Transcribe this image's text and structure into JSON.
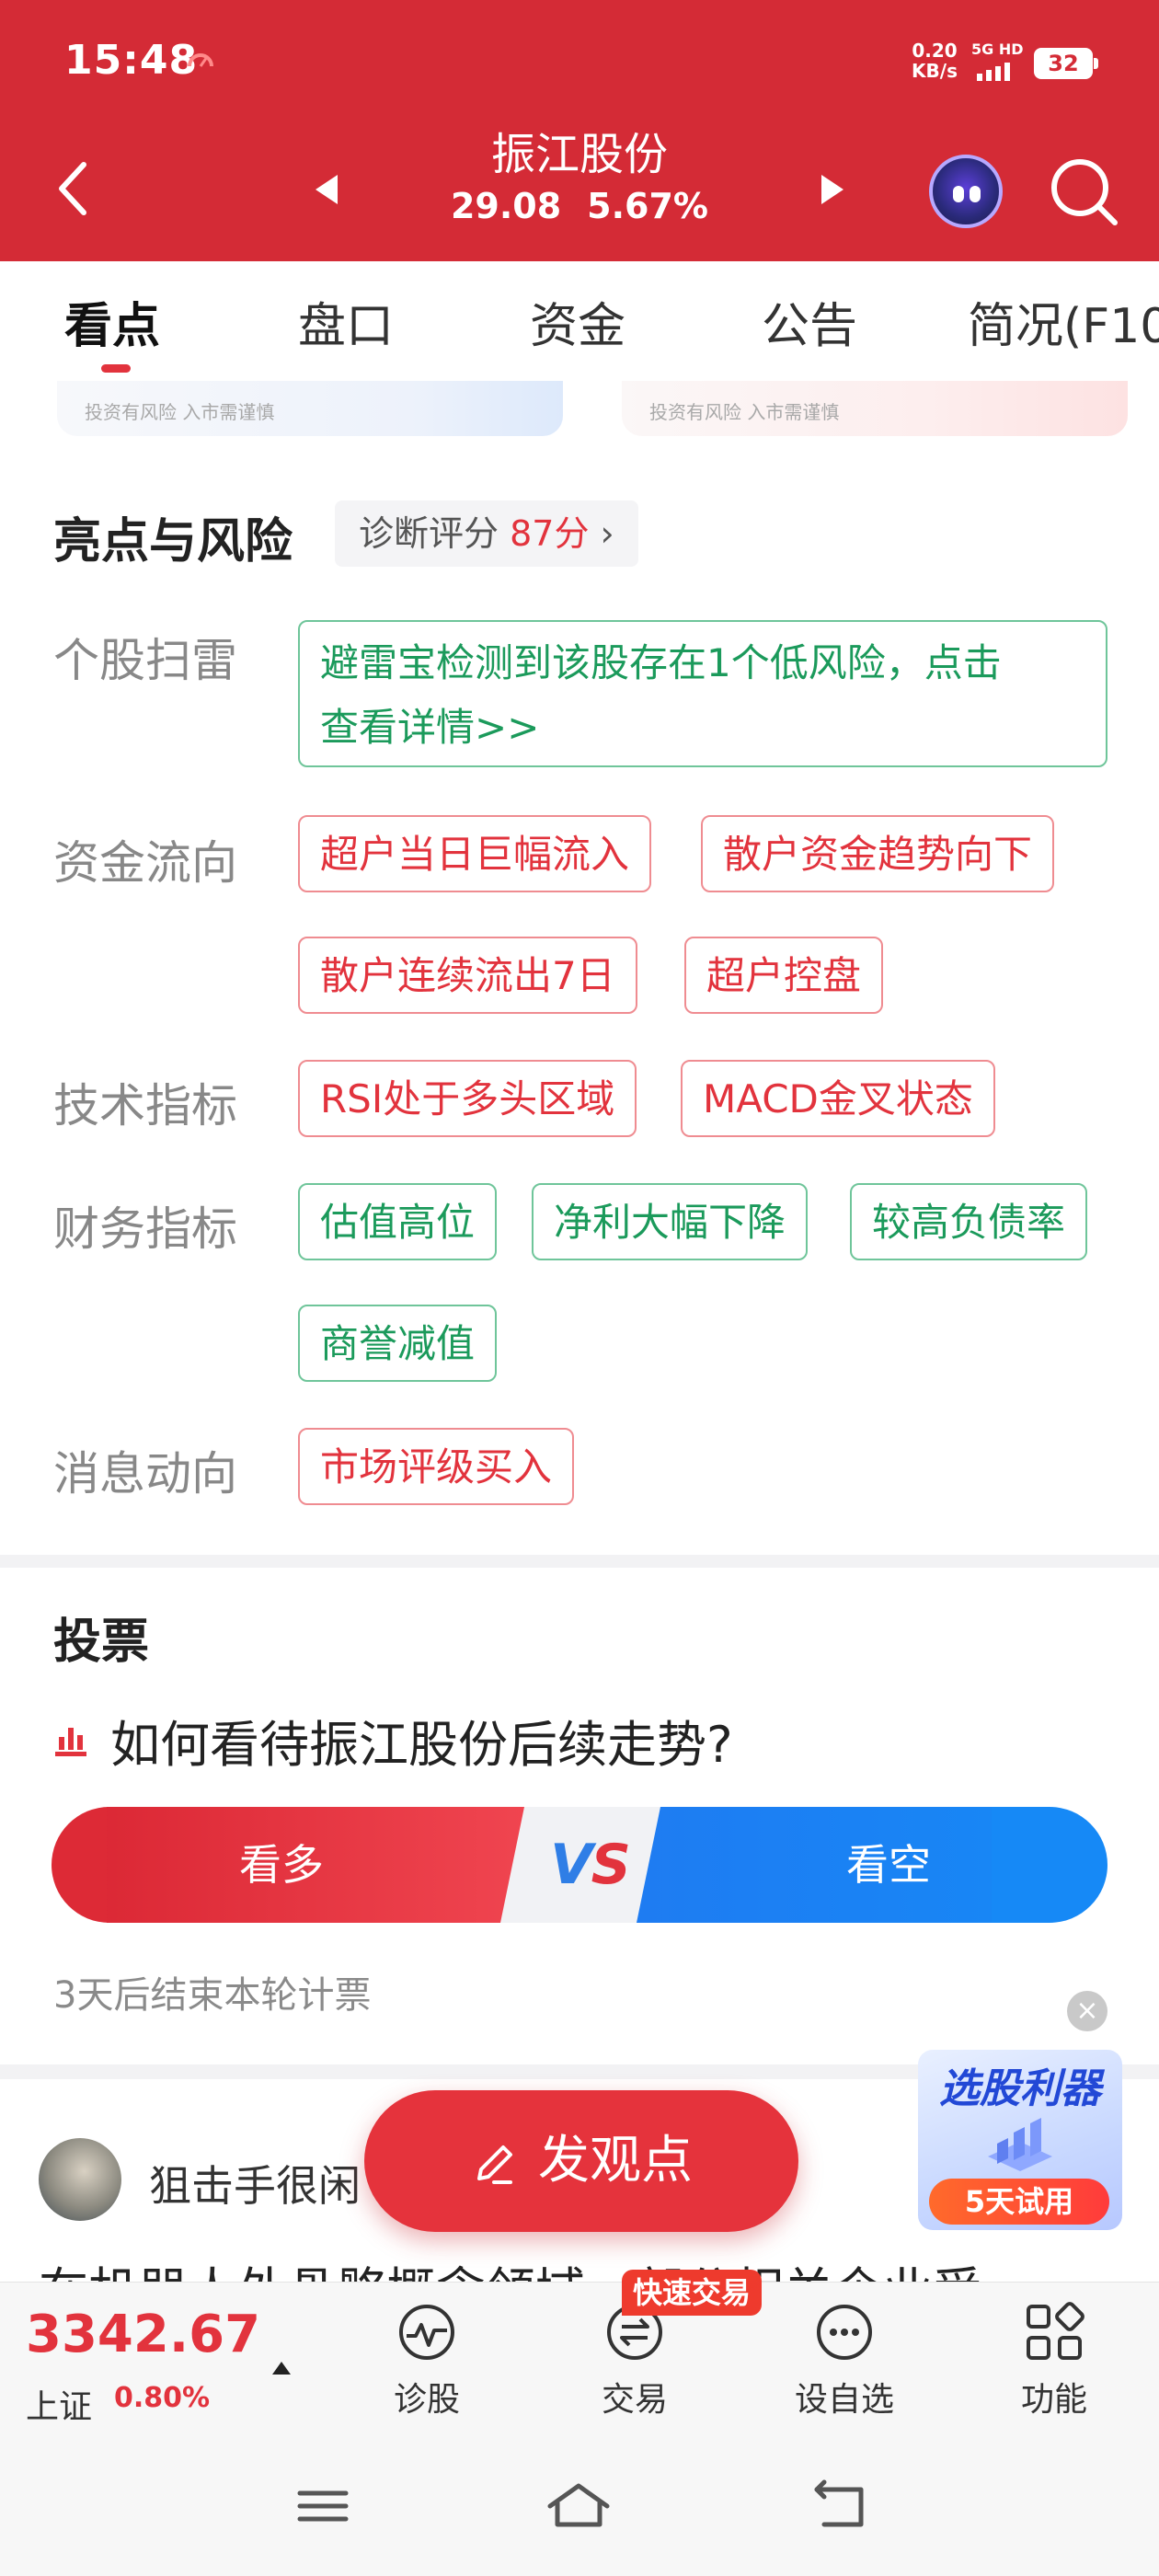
{
  "status_bar": {
    "time": "15:48",
    "net_speed_value": "0.20",
    "net_speed_unit": "KB/s",
    "network": "5G HD",
    "battery": "32"
  },
  "header": {
    "stock_name": "振江股份",
    "price": "29.08",
    "change_pct": "5.67%"
  },
  "tabs": [
    {
      "label": "看点",
      "active": true
    },
    {
      "label": "盘口",
      "active": false
    },
    {
      "label": "资金",
      "active": false
    },
    {
      "label": "公告",
      "active": false
    },
    {
      "label": "简况(F10",
      "active": false
    }
  ],
  "banners": {
    "left_note": "投资有风险  入市需谨慎",
    "right_note": "投资有风险  入市需谨慎"
  },
  "highlights": {
    "title": "亮点与风险",
    "score_prefix": "诊断评分 ",
    "score_value": "87分",
    "score_chevron": "›",
    "rows": {
      "scan": {
        "label": "个股扫雷",
        "text_line1": "避雷宝检测到该股存在1个低风险，点击",
        "text_line2": "查看详情>>"
      },
      "fund_flow": {
        "label": "资金流向",
        "tags": [
          "超户当日巨幅流入",
          "散户资金趋势向下",
          "散户连续流出7日",
          "超户控盘"
        ]
      },
      "technical": {
        "label": "技术指标",
        "tags": [
          "RSI处于多头区域",
          "MACD金叉状态"
        ]
      },
      "financial": {
        "label": "财务指标",
        "tags": [
          "估值高位",
          "净利大幅下降",
          "较高负债率",
          "商誉减值"
        ]
      },
      "news": {
        "label": "消息动向",
        "tags": [
          "市场评级买入"
        ]
      }
    }
  },
  "vote": {
    "title": "投票",
    "question": "如何看待振江股份后续走势?",
    "bull_label": "看多",
    "vs_v": "V",
    "vs_s": "S",
    "bear_label": "看空",
    "end_note": "3天后结束本轮计票"
  },
  "post": {
    "author": "狙击手很闲",
    "text": "在机器人外骨骼概念领域，部分相关企业受"
  },
  "fab": {
    "label": "发观点"
  },
  "promo": {
    "title": "选股利器",
    "badge": "5天试用"
  },
  "bottom_bar": {
    "index_value": "3342.67",
    "index_name": "上证",
    "index_change": "0.80%",
    "tools": [
      {
        "label": "诊股",
        "icon": "diagnose-icon"
      },
      {
        "label": "交易",
        "icon": "trade-icon"
      },
      {
        "label": "设自选",
        "icon": "watchlist-icon"
      },
      {
        "label": "功能",
        "icon": "grid-icon"
      }
    ],
    "quick_trade_badge": "快速交易"
  },
  "colors": {
    "brand_red": "#d42b36",
    "risk_red": "#e2333d",
    "positive_green": "#1b9a5b",
    "bear_blue": "#1e7cf2"
  }
}
